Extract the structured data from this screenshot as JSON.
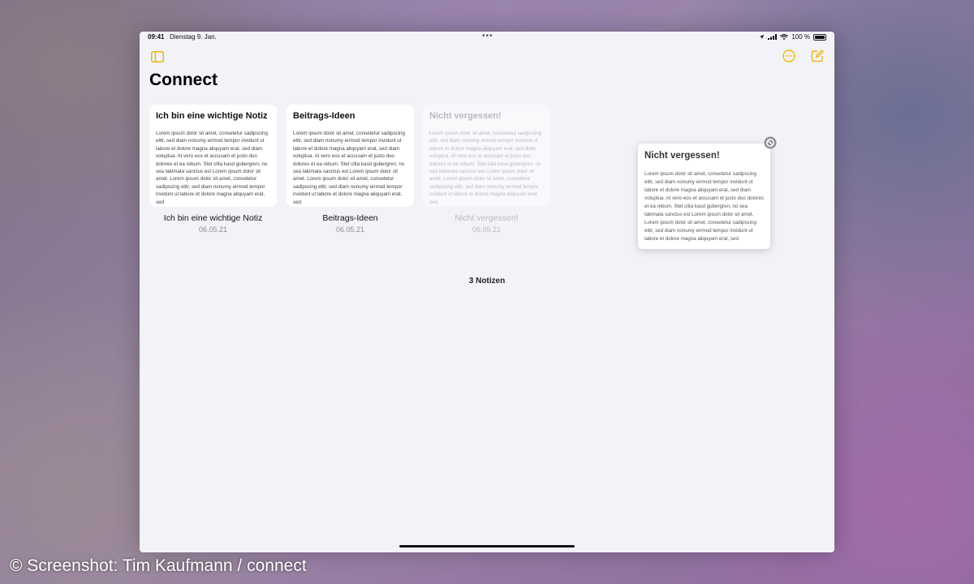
{
  "status_bar": {
    "time": "09:41",
    "date": "Dienstag 9. Jan.",
    "multitasking_dots": "•••",
    "battery_text": "100 %",
    "icons": [
      "location-icon",
      "cellular-icon",
      "wifi-icon",
      "battery-icon"
    ]
  },
  "toolbar": {
    "sidebar_icon": "sidebar-icon",
    "more_icon": "ellipsis-circle-icon",
    "compose_icon": "compose-icon",
    "accent_color": "#e9b80f"
  },
  "folder": {
    "title": "Connect"
  },
  "notes": [
    {
      "card_title": "Ich bin eine wichtige Notiz",
      "card_body": "Lorem ipsum dolor sit amet, consetetur sadipscing elitr, sed diam nonumy eirmod tempor invidunt ut labore et dolore magna aliquyam erat, sed diam voluptua. At vero eos et accusam et justo duo dolores et ea rebum. Stet clita kasd gubergren, no sea takimata sanctus est Lorem ipsum dolor sit amet. Lorem ipsum dolor sit amet, consetetur sadipscing elitr, sed diam nonumy eirmod tempor invidunt ut labore et dolore magna aliquyam erat, sed",
      "title": "Ich bin eine wichtige Notiz",
      "date": "06.05.21"
    },
    {
      "card_title": "Beitrags-Ideen",
      "card_body": "Lorem ipsum dolor sit amet, consetetur sadipscing elitr, sed diam nonumy eirmod tempor invidunt ut labore et dolore magna aliquyam erat, sed diam voluptua. At vero eos et accusam et justo duo dolores et ea rebum. Stet clita kasd gubergren, no sea takimata sanctus est Lorem ipsum dolor sit amet. Lorem ipsum dolor sit amet, consetetur sadipscing elitr, sed diam nonumy eirmod tempor invidunt ut labore et dolore magna aliquyam erat, sed",
      "title": "Beitrags-Ideen",
      "date": "06.05.21"
    },
    {
      "card_title": "Nicht vergessen!",
      "card_body": "Lorem ipsum dolor sit amet, consetetur sadipscing elitr, sed diam nonumy eirmod tempor invidunt ut labore et dolore magna aliquyam erat, sed diam voluptua. At vero eos et accusam et justo duo dolores et ea rebum. Stet clita kasd gubergren, no sea takimata sanctus est Lorem ipsum dolor sit amet. Lorem ipsum dolor sit amet, consetetur sadipscing elitr, sed diam nonumy eirmod tempor invidunt ut labore et dolore magna aliquyam erat, sed",
      "title": "Nicht vergessen!",
      "date": "06.05.21",
      "state": "being-dragged"
    }
  ],
  "notes_count": "3 Notizen",
  "drag_preview": {
    "title": "Nicht vergessen!",
    "body": "Lorem ipsum dolor sit amet, consetetur sadipscing elitr, sed diam nonumy eirmod tempor invidunt ut labore et dolore magna aliquyam erat, sed diam voluptua. At vero eos et accusam et justo duo dolores et ea rebum. Stet clita kasd gubergren, no sea takimata sanctus est Lorem ipsum dolor sit amet. Lorem ipsum dolor sit amet, consetetur sadipscing elitr, sed diam nonumy eirmod tempor invidunt ut labore et dolore magna aliquyam erat, sed",
    "badge_icon": "no-drop-icon"
  },
  "credit": "© Screenshot: Tim Kaufmann / connect"
}
